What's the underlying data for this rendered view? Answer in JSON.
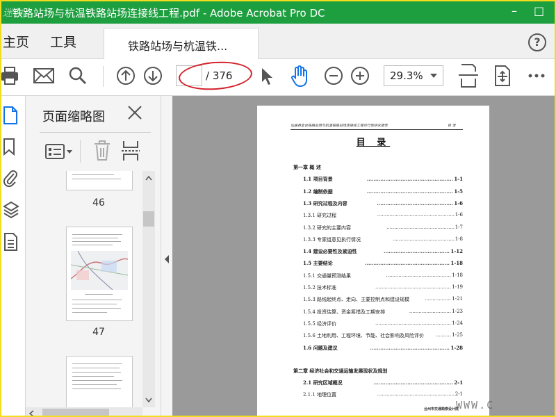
{
  "window": {
    "title": "铁路站场与杭温铁路站场连接线工程.pdf - Adobe Acrobat Pro DC",
    "watermark": "迷你",
    "controls": [
      "–",
      "□"
    ]
  },
  "tabs": {
    "home": "主页",
    "tools": "工具",
    "document": "铁路站场与杭温铁..."
  },
  "toolbar": {
    "page_current": "",
    "page_total": "/ 376",
    "zoom": "29.3%"
  },
  "panel": {
    "title": "页面缩略图",
    "thumbnails": [
      {
        "label": "46"
      },
      {
        "label": "47"
      },
      {
        "label": ""
      }
    ]
  },
  "pdf": {
    "header_left": "仙居县金台铁路站场与杭温铁路站场连接线工程可行性研究报告",
    "header_right": "目 录",
    "toc_title": "目 录",
    "footer": "台州市交通勘察设计院",
    "toc": [
      {
        "text": "第一章  概  述",
        "page": "",
        "level": 0
      },
      {
        "text": "1.1  项目背景",
        "page": "1-1",
        "level": 1
      },
      {
        "text": "1.2  编制依据",
        "page": "1-5",
        "level": 1
      },
      {
        "text": "1.3  研究过程及内容",
        "page": "1-6",
        "level": 1
      },
      {
        "text": "1.3.1  研究过程",
        "page": "1-6",
        "level": 2
      },
      {
        "text": "1.3.2  研究的主要内容",
        "page": "1-7",
        "level": 2
      },
      {
        "text": "1.3.3  专家组意见执行情况",
        "page": "1-8",
        "level": 2
      },
      {
        "text": "1.4  建设必要性及紧迫性",
        "page": "1-12",
        "level": 1
      },
      {
        "text": "1.5  主要结论",
        "page": "1-18",
        "level": 1
      },
      {
        "text": "1.5.1  交通量预测结果",
        "page": "1-18",
        "level": 2
      },
      {
        "text": "1.5.2  技术标准",
        "page": "1-19",
        "level": 2
      },
      {
        "text": "1.5.3  路线起终点、走向、主要控制点和建设规模",
        "page": "1-21",
        "level": 2
      },
      {
        "text": "1.5.4  投资估算、资金筹措及工期安排",
        "page": "1-23",
        "level": 2
      },
      {
        "text": "1.5.5  经济评价",
        "page": "1-24",
        "level": 2
      },
      {
        "text": "1.5.6  土地利用、工程环境、节能、社会影响及风险评价",
        "page": "1-25",
        "level": 2
      },
      {
        "text": "1.6  问题及建议",
        "page": "1-28",
        "level": 1
      },
      {
        "text": "第二章  经济社会和交通运输发展现状及规划",
        "page": "",
        "level": 0
      },
      {
        "text": "2.1  研究区域概况",
        "page": "2-1",
        "level": 1
      },
      {
        "text": "2.1.1  地理位置",
        "page": "2-1",
        "level": 2
      }
    ]
  },
  "overlay": {
    "url_watermark": "WWW.C"
  },
  "colors": {
    "titlebar": "#1d9e3f",
    "accent_blue": "#1473e6",
    "annotation_red": "#d3202a",
    "frame_yellow": "#f2dc1e"
  }
}
